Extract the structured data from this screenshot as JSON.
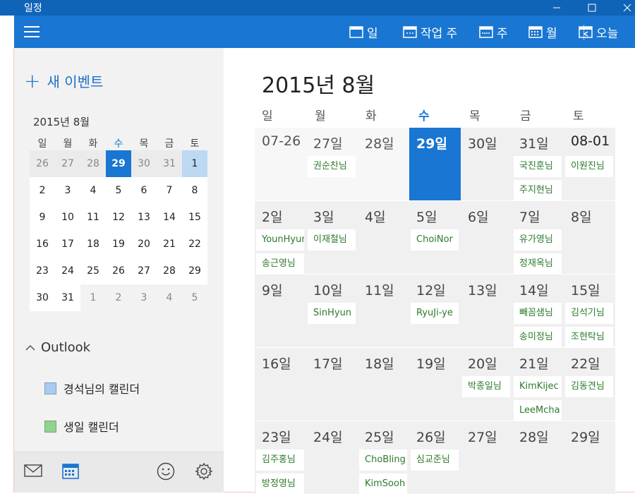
{
  "window": {
    "title": "일정"
  },
  "toolbar": {
    "day_label": "일",
    "workweek_label": "작업 주",
    "week_label": "주",
    "month_label": "월",
    "today_label": "오늘"
  },
  "sidebar": {
    "new_event": "새 이벤트",
    "mini_title": "2015년 8월",
    "weekdays": [
      "일",
      "월",
      "화",
      "수",
      "목",
      "금",
      "토"
    ],
    "weeks": [
      [
        "26",
        "27",
        "28",
        "29",
        "30",
        "31",
        "1"
      ],
      [
        "2",
        "3",
        "4",
        "5",
        "6",
        "7",
        "8"
      ],
      [
        "9",
        "10",
        "11",
        "12",
        "13",
        "14",
        "15"
      ],
      [
        "16",
        "17",
        "18",
        "19",
        "20",
        "21",
        "22"
      ],
      [
        "23",
        "24",
        "25",
        "26",
        "27",
        "28",
        "29"
      ],
      [
        "30",
        "31",
        "1",
        "2",
        "3",
        "4",
        "5"
      ]
    ],
    "outlook_label": "Outlook",
    "calendars": [
      {
        "name": "경석님의 캘린더",
        "color": "#a9ccee"
      },
      {
        "name": "생일 캘린더",
        "color": "#90d28e"
      }
    ]
  },
  "main": {
    "month_title": "2015년 8월",
    "weekdays": [
      "일",
      "월",
      "화",
      "수",
      "목",
      "금",
      "토"
    ],
    "weeks": [
      [
        {
          "num": "07-26",
          "events": []
        },
        {
          "num": "27일",
          "events": [
            "권순찬님"
          ]
        },
        {
          "num": "28일",
          "events": []
        },
        {
          "num": "29일",
          "events": []
        },
        {
          "num": "30일",
          "events": []
        },
        {
          "num": "31일",
          "events": [
            "국진훈님",
            "주지현님"
          ]
        },
        {
          "num": "08-01",
          "events": [
            "이원진님"
          ]
        }
      ],
      [
        {
          "num": "2일",
          "events": [
            "YounHyun",
            "송근영님"
          ]
        },
        {
          "num": "3일",
          "events": [
            "이재철님"
          ]
        },
        {
          "num": "4일",
          "events": []
        },
        {
          "num": "5일",
          "events": [
            "ChoiNor"
          ]
        },
        {
          "num": "6일",
          "events": []
        },
        {
          "num": "7일",
          "events": [
            "유가영님",
            "정재옥님"
          ]
        },
        {
          "num": "8일",
          "events": []
        }
      ],
      [
        {
          "num": "9일",
          "events": []
        },
        {
          "num": "10일",
          "events": [
            "SinHyun"
          ]
        },
        {
          "num": "11일",
          "events": []
        },
        {
          "num": "12일",
          "events": [
            "RyuJi-ye"
          ]
        },
        {
          "num": "13일",
          "events": []
        },
        {
          "num": "14일",
          "events": [
            "빼꼼샘님",
            "송미정님"
          ]
        },
        {
          "num": "15일",
          "events": [
            "김석기님",
            "조현탁님"
          ]
        }
      ],
      [
        {
          "num": "16일",
          "events": []
        },
        {
          "num": "17일",
          "events": []
        },
        {
          "num": "18일",
          "events": []
        },
        {
          "num": "19일",
          "events": []
        },
        {
          "num": "20일",
          "events": [
            "박종일님"
          ]
        },
        {
          "num": "21일",
          "events": [
            "KimKijec",
            "LeeMcha"
          ]
        },
        {
          "num": "22일",
          "events": [
            "김동견님"
          ]
        }
      ],
      [
        {
          "num": "23일",
          "events": [
            "김주홍님",
            "방정영님"
          ]
        },
        {
          "num": "24일",
          "events": []
        },
        {
          "num": "25일",
          "events": [
            "ChoBling",
            "KimSooh"
          ]
        },
        {
          "num": "26일",
          "events": [
            "심교준님"
          ]
        },
        {
          "num": "27일",
          "events": []
        },
        {
          "num": "28일",
          "events": []
        },
        {
          "num": "29일",
          "events": []
        }
      ]
    ]
  },
  "colors": {
    "accent": "#1976d2",
    "titlebar": "#0f64b8",
    "event_text": "#2c7a2c"
  }
}
